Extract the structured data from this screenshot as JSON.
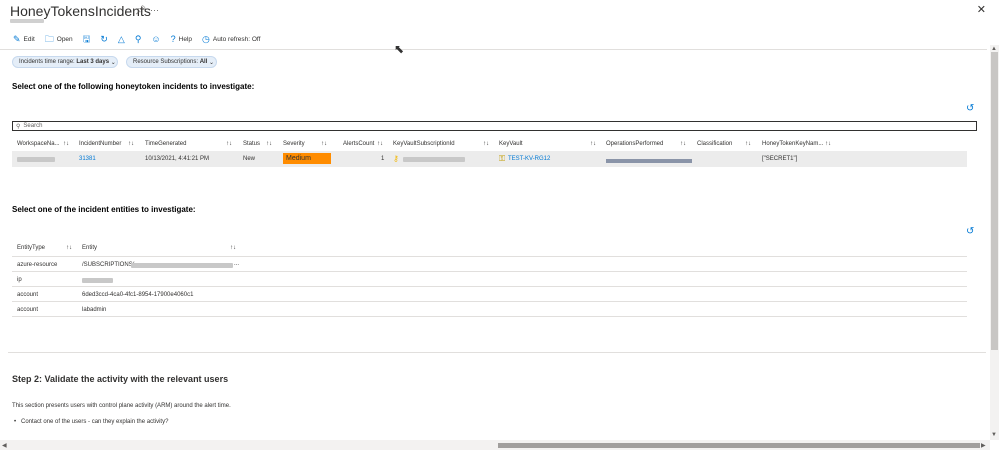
{
  "header": {
    "title": "HoneyTokensIncidents",
    "pin_icon": "pin-icon",
    "more_icon": "more-icon",
    "close_icon": "close-icon"
  },
  "toolbar": {
    "edit": "Edit",
    "open": "Open",
    "help": "Help",
    "auto_refresh": "Auto refresh: Off"
  },
  "filters": {
    "time_range_label": "Incidents time range:",
    "time_range_value": "Last 3 days",
    "subscriptions_label": "Resource Subscriptions:",
    "subscriptions_value": "All"
  },
  "incidents": {
    "heading": "Select one of the following honeytoken incidents to investigate:",
    "search_placeholder": "Search",
    "columns": [
      "WorkspaceNa...",
      "IncidentNumber",
      "TimeGenerated",
      "Status",
      "Severity",
      "AlertsCount",
      "KeyVaultSubscriptionId",
      "KeyVault",
      "OperationsPerformed",
      "Classification",
      "HoneyTokenKeyNam..."
    ],
    "row": {
      "incident_number": "31381",
      "time_generated": "10/13/2021, 4:41:21 PM",
      "status": "New",
      "severity": "Medium",
      "alerts_count": "1",
      "key_vault": "TEST-KV-RG12",
      "honeytoken_key_name": "[\"SECRET1\"]"
    },
    "severity_color": "#ff8c00"
  },
  "entities": {
    "heading": "Select one of the incident entities to investigate:",
    "columns": [
      "EntityType",
      "Entity"
    ],
    "rows": [
      {
        "type": "azure-resource",
        "entity": "/SUBSCRIPTIONS/",
        "entity_suffix": "..."
      },
      {
        "type": "ip",
        "entity": ""
      },
      {
        "type": "account",
        "entity": "6ded3ccd-4ca0-4fc1-8954-17900e4060c1"
      },
      {
        "type": "account",
        "entity": "labadmin"
      }
    ]
  },
  "step2": {
    "heading": "Step 2: Validate the activity with the relevant users",
    "description": "This section presents users with control plane activity (ARM) around the alert time.",
    "bullet": "Contact one of the users - can they explain the activity?"
  },
  "colors": {
    "accent": "#0078d4",
    "severity_medium": "#ff8c00"
  }
}
